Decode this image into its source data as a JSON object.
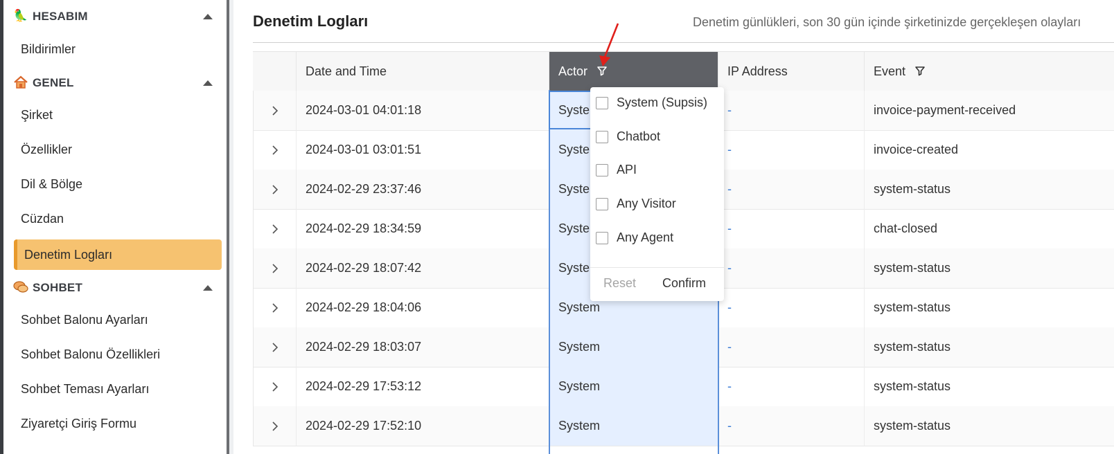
{
  "sidebar": {
    "sections": [
      {
        "title": "HESABIM",
        "icon": "bird-icon",
        "items": [
          "Bildirimler"
        ]
      },
      {
        "title": "GENEL",
        "icon": "home-icon",
        "items": [
          "Şirket",
          "Özellikler",
          "Dil & Bölge",
          "Cüzdan",
          "Denetim Logları"
        ]
      },
      {
        "title": "SOHBET",
        "icon": "chat-bubbles-icon",
        "items": [
          "Sohbet Balonu Ayarları",
          "Sohbet Balonu Özellikleri",
          "Sohbet Teması Ayarları",
          "Ziyaretçi Giriş Formu"
        ]
      }
    ],
    "active_item": "Denetim Logları"
  },
  "main": {
    "title": "Denetim Logları",
    "description": "Denetim günlükleri, son 30 gün içinde şirketinizde gerçekleşen olayları"
  },
  "table": {
    "columns": [
      "Date and Time",
      "Actor",
      "IP Address",
      "Event"
    ],
    "rows": [
      {
        "datetime": "2024-03-01 04:01:18",
        "actor": "Syste",
        "ip": "-",
        "event": "invoice-payment-received"
      },
      {
        "datetime": "2024-03-01 03:01:51",
        "actor": "Syste",
        "ip": "-",
        "event": "invoice-created"
      },
      {
        "datetime": "2024-02-29 23:37:46",
        "actor": "Syste",
        "ip": "-",
        "event": "system-status"
      },
      {
        "datetime": "2024-02-29 18:34:59",
        "actor": "Syste",
        "ip": "-",
        "event": "chat-closed"
      },
      {
        "datetime": "2024-02-29 18:07:42",
        "actor": "Syste",
        "ip": "-",
        "event": "system-status"
      },
      {
        "datetime": "2024-02-29 18:04:06",
        "actor": "System",
        "ip": "-",
        "event": "system-status"
      },
      {
        "datetime": "2024-02-29 18:03:07",
        "actor": "System",
        "ip": "-",
        "event": "system-status"
      },
      {
        "datetime": "2024-02-29 17:53:12",
        "actor": "System",
        "ip": "-",
        "event": "system-status"
      },
      {
        "datetime": "2024-02-29 17:52:10",
        "actor": "System",
        "ip": "-",
        "event": "system-status"
      }
    ]
  },
  "actor_filter": {
    "options": [
      "System (Supsis)",
      "Chatbot",
      "API",
      "Any Visitor",
      "Any Agent"
    ],
    "reset_label": "Reset",
    "confirm_label": "Confirm"
  },
  "colors": {
    "active_bg": "#f6c270",
    "active_border": "#e89a2c",
    "actor_header": "#5f6166",
    "actor_column": "#e5efff",
    "ip_dash": "#3a7bd5",
    "annotation_arrow": "#e0201b"
  }
}
